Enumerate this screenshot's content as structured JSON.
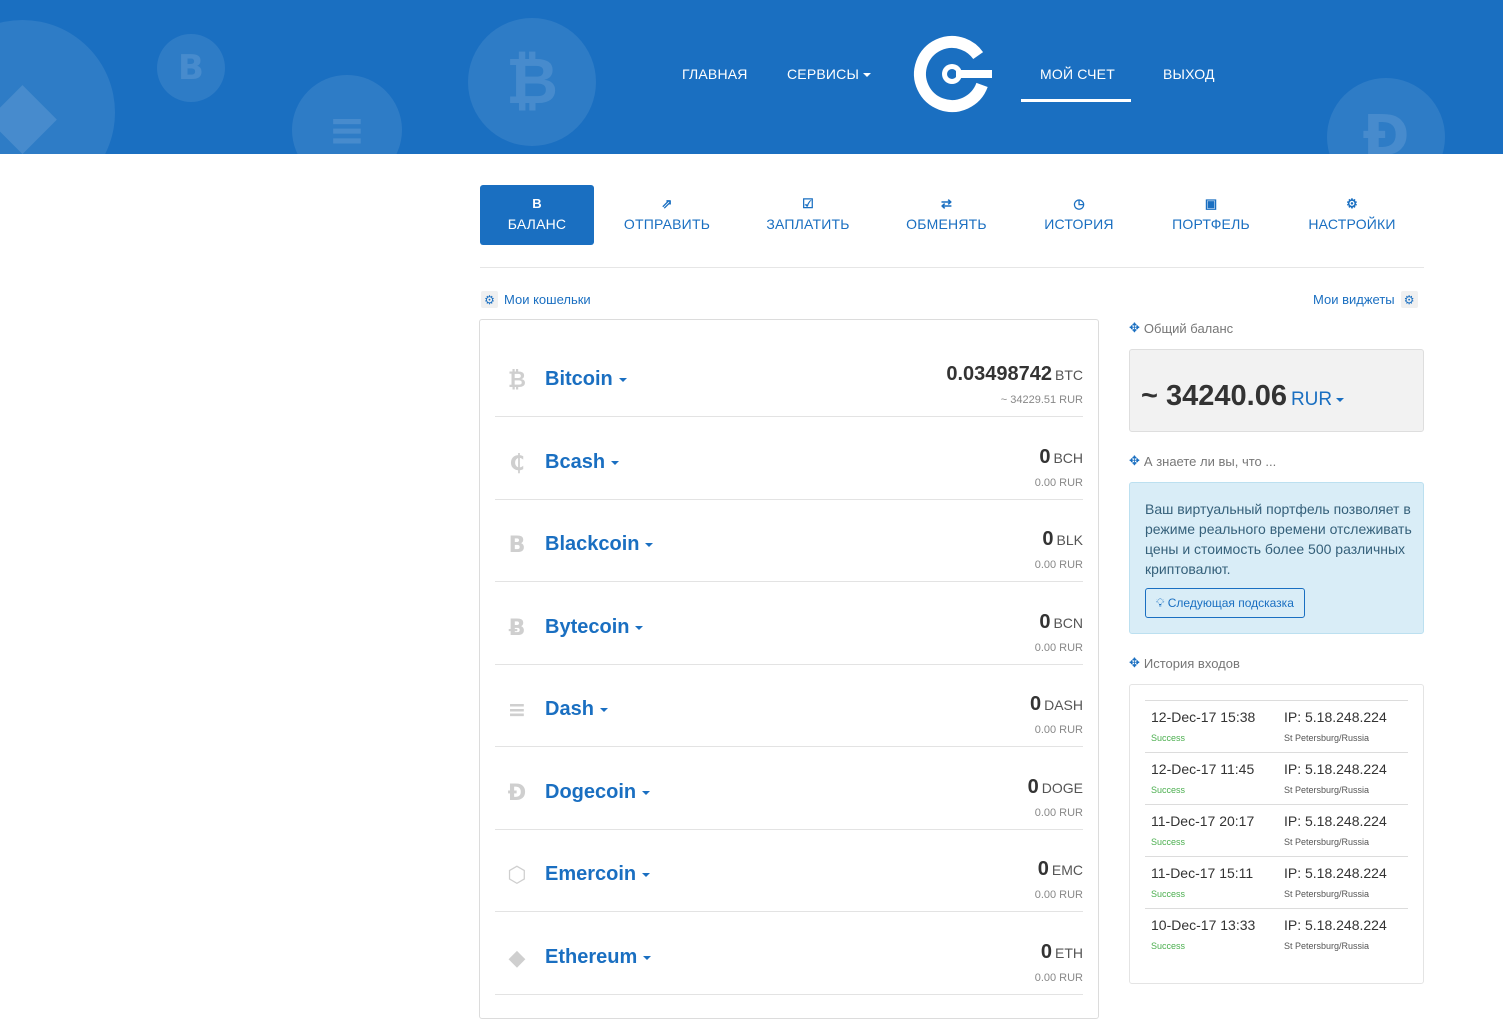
{
  "nav": {
    "home": "ГЛАВНАЯ",
    "services": "СЕРВИСЫ",
    "account": "МОЙ СЧЕТ",
    "logout": "ВЫХОД"
  },
  "tabs": [
    {
      "label": "БАЛАНС",
      "icon": "bitcoin-icon",
      "active": true
    },
    {
      "label": "ОТПРАВИТЬ",
      "icon": "send-icon",
      "active": false
    },
    {
      "label": "ЗАПЛАТИТЬ",
      "icon": "pay-check-icon",
      "active": false
    },
    {
      "label": "ОБМЕНЯТЬ",
      "icon": "exchange-icon",
      "active": false
    },
    {
      "label": "ИСТОРИЯ",
      "icon": "clock-icon",
      "active": false
    },
    {
      "label": "ПОРТФЕЛЬ",
      "icon": "briefcase-icon",
      "active": false
    },
    {
      "label": "НАСТРОЙКИ",
      "icon": "gear-icon",
      "active": false
    }
  ],
  "wallets_link": "Мои кошельки",
  "widgets_link": "Мои виджеты",
  "wallets": [
    {
      "name": "Bitcoin",
      "amount": "0.03498742",
      "symbol": "BTC",
      "sub": "~ 34229.51 RUR",
      "icon": "bitcoin-icon"
    },
    {
      "name": "Bcash",
      "amount": "0",
      "symbol": "BCH",
      "sub": "0.00 RUR",
      "icon": "bcash-icon"
    },
    {
      "name": "Blackcoin",
      "amount": "0",
      "symbol": "BLK",
      "sub": "0.00 RUR",
      "icon": "blackcoin-icon"
    },
    {
      "name": "Bytecoin",
      "amount": "0",
      "symbol": "BCN",
      "sub": "0.00 RUR",
      "icon": "bytecoin-icon"
    },
    {
      "name": "Dash",
      "amount": "0",
      "symbol": "DASH",
      "sub": "0.00 RUR",
      "icon": "dash-icon"
    },
    {
      "name": "Dogecoin",
      "amount": "0",
      "symbol": "DOGE",
      "sub": "0.00 RUR",
      "icon": "dogecoin-icon"
    },
    {
      "name": "Emercoin",
      "amount": "0",
      "symbol": "EMC",
      "sub": "0.00 RUR",
      "icon": "emercoin-icon"
    },
    {
      "name": "Ethereum",
      "amount": "0",
      "symbol": "ETH",
      "sub": "0.00 RUR",
      "icon": "ethereum-icon"
    }
  ],
  "total": {
    "label": "Общий баланс",
    "value": "~ 34240.06",
    "currency": "RUR"
  },
  "tip": {
    "label": "А знаете ли вы, что ...",
    "text": "Ваш виртуальный портфель позволяет в режиме реального времени отслеживать цены и стоимость более 500 различных криптовалют.",
    "button": "Следующая подсказка"
  },
  "logins": {
    "label": "История входов",
    "rows": [
      {
        "date": "12-Dec-17 15:38",
        "ip": "IP: 5.18.248.224",
        "status": "Success",
        "location": "St Petersburg/Russia"
      },
      {
        "date": "12-Dec-17 11:45",
        "ip": "IP: 5.18.248.224",
        "status": "Success",
        "location": "St Petersburg/Russia"
      },
      {
        "date": "11-Dec-17 20:17",
        "ip": "IP: 5.18.248.224",
        "status": "Success",
        "location": "St Petersburg/Russia"
      },
      {
        "date": "11-Dec-17 15:11",
        "ip": "IP: 5.18.248.224",
        "status": "Success",
        "location": "St Petersburg/Russia"
      },
      {
        "date": "10-Dec-17 13:33",
        "ip": "IP: 5.18.248.224",
        "status": "Success",
        "location": "St Petersburg/Russia"
      }
    ]
  },
  "colors": {
    "brand": "#1a6fc1",
    "success": "#4caf50",
    "tip_bg": "#d9edf7"
  }
}
